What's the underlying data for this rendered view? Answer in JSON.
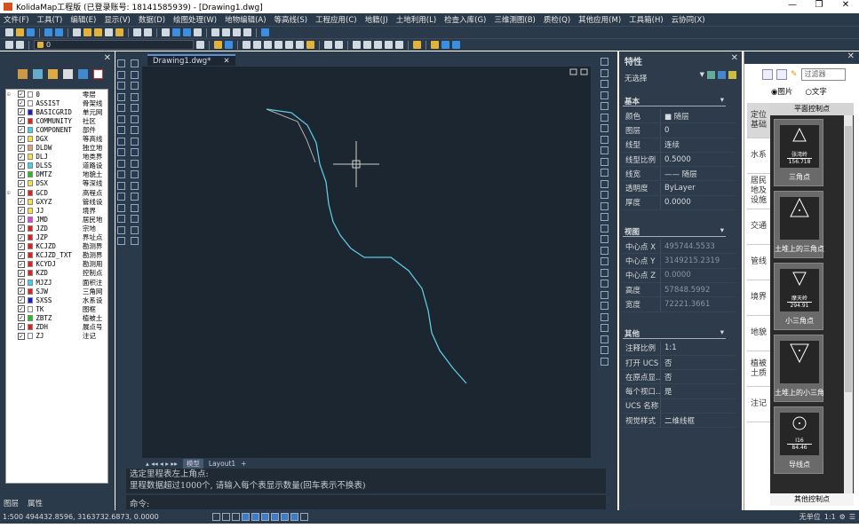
{
  "window": {
    "title": "KolidaMap工程版  (已登录账号: 18141585939)  - [Drawing1.dwg]",
    "controls": [
      "—",
      "❐",
      "✕"
    ]
  },
  "menu": [
    "文件(F)",
    "工具(T)",
    "编辑(E)",
    "显示(V)",
    "数据(D)",
    "绘图处理(W)",
    "地物编辑(A)",
    "等高线(S)",
    "工程应用(C)",
    "地籍(J)",
    "土地利用(L)",
    "检查入库(G)",
    "三维测图(B)",
    "质检(Q)",
    "其他应用(M)",
    "工具箱(H)",
    "云协同(X)"
  ],
  "toolbar": {
    "layer_value": "0"
  },
  "layer_panel": {
    "layers": [
      {
        "name": "0",
        "desc": "零层",
        "color": "#ffffff",
        "expand": true
      },
      {
        "name": "ASSIST",
        "desc": "骨架线",
        "color": "#ffffff"
      },
      {
        "name": "BASICGRID",
        "desc": "单元网",
        "color": "#1a1ad0"
      },
      {
        "name": "COMMUNITY",
        "desc": "社区",
        "color": "#e02020"
      },
      {
        "name": "COMPONENT",
        "desc": "部件",
        "color": "#40d0f0"
      },
      {
        "name": "DGX",
        "desc": "等高线",
        "color": "#f8e040"
      },
      {
        "name": "DLDW",
        "desc": "独立地",
        "color": "#e0a080"
      },
      {
        "name": "DLJ",
        "desc": "地类界",
        "color": "#f8e040"
      },
      {
        "name": "DLSS",
        "desc": "道路设",
        "color": "#40d0f0"
      },
      {
        "name": "DMTZ",
        "desc": "地貌土",
        "color": "#20c020"
      },
      {
        "name": "DSX",
        "desc": "等深线",
        "color": "#f8e040"
      },
      {
        "name": "GCD",
        "desc": "高程点",
        "color": "#e02020",
        "expand": true
      },
      {
        "name": "GXYZ",
        "desc": "管线设",
        "color": "#f8e040"
      },
      {
        "name": "JJ",
        "desc": "境界",
        "color": "#f8e040"
      },
      {
        "name": "JMD",
        "desc": "居民地",
        "color": "#e040e0"
      },
      {
        "name": "JZD",
        "desc": "宗地",
        "color": "#e02020"
      },
      {
        "name": "JZP",
        "desc": "界址点",
        "color": "#e02020"
      },
      {
        "name": "KCJZD",
        "desc": "勘测界",
        "color": "#e02020"
      },
      {
        "name": "KCJZD_TXT",
        "desc": "勘测界",
        "color": "#e02020"
      },
      {
        "name": "KCYDJ",
        "desc": "勘测用",
        "color": "#e02020"
      },
      {
        "name": "KZD",
        "desc": "控制点",
        "color": "#e02020"
      },
      {
        "name": "MJZJ",
        "desc": "面积注",
        "color": "#40d0f0"
      },
      {
        "name": "SJW",
        "desc": "三角网",
        "color": "#e02020"
      },
      {
        "name": "SXSS",
        "desc": "水系设",
        "color": "#1a1ad0"
      },
      {
        "name": "TK",
        "desc": "图框",
        "color": "#ffffff"
      },
      {
        "name": "ZBTZ",
        "desc": "植被土",
        "color": "#20c020"
      },
      {
        "name": "ZDH",
        "desc": "展点号",
        "color": "#e02020"
      },
      {
        "name": "ZJ",
        "desc": "注记",
        "color": "#ffffff"
      }
    ],
    "tabs": [
      "图层",
      "属性"
    ]
  },
  "document": {
    "tab": "Drawing1.dwg*",
    "layout_tabs": [
      "模型",
      "Layout1",
      "+"
    ]
  },
  "command": {
    "history": [
      "选定里程表左上角点:",
      "里程数据超过1000个, 请输入每个表显示数量(回车表示不换表)"
    ],
    "prompt": "命令:"
  },
  "properties": {
    "title": "特性",
    "selection": "无选择",
    "sections": [
      {
        "name": "基本",
        "rows": [
          [
            "颜色",
            "■ 随层"
          ],
          [
            "图层",
            "0"
          ],
          [
            "线型",
            "连续"
          ],
          [
            "线型比例",
            "0.5000"
          ],
          [
            "线宽",
            "—— 随层"
          ],
          [
            "透明度",
            "ByLayer"
          ],
          [
            "厚度",
            "0.0000"
          ]
        ]
      },
      {
        "name": "视图",
        "rows": [
          [
            "中心点 X",
            "495744.5533"
          ],
          [
            "中心点 Y",
            "3149215.2319"
          ],
          [
            "中心点 Z",
            "0.0000"
          ],
          [
            "高度",
            "57848.5992"
          ],
          [
            "宽度",
            "72221.3661"
          ]
        ]
      },
      {
        "name": "其他",
        "rows": [
          [
            "注释比例",
            "1:1"
          ],
          [
            "打开 UCS ...",
            "否"
          ],
          [
            "在原点显...",
            "否"
          ],
          [
            "每个视口...",
            "是"
          ],
          [
            "UCS 名称",
            ""
          ],
          [
            "视觉样式",
            "二维线框"
          ]
        ]
      }
    ]
  },
  "symbols": {
    "filter_placeholder": "过滤器",
    "radio": [
      "图片",
      "文字"
    ],
    "categories": [
      "定位基础",
      "水系",
      "居民地及设施",
      "交通",
      "管线",
      "境界",
      "地貌",
      "植被土质",
      "注记"
    ],
    "group_title": "平面控制点",
    "items": [
      {
        "label": "三角点",
        "top": "张湾岭",
        "bottom": "156.718"
      },
      {
        "label": "土堆上的三角点",
        "top": "",
        "bottom": ""
      },
      {
        "label": "小三角点",
        "top": "摩天岭",
        "bottom": "294.91"
      },
      {
        "label": "土堆上的小三角点",
        "top": "",
        "bottom": ""
      },
      {
        "label": "导线点",
        "top": "I16",
        "bottom": "84.46"
      }
    ],
    "footer": "其他控制点"
  },
  "status": {
    "coords": "1:500 494432.8596, 3163732.6873, 0.0000",
    "unit": "无单位",
    "scale": "1:1"
  }
}
